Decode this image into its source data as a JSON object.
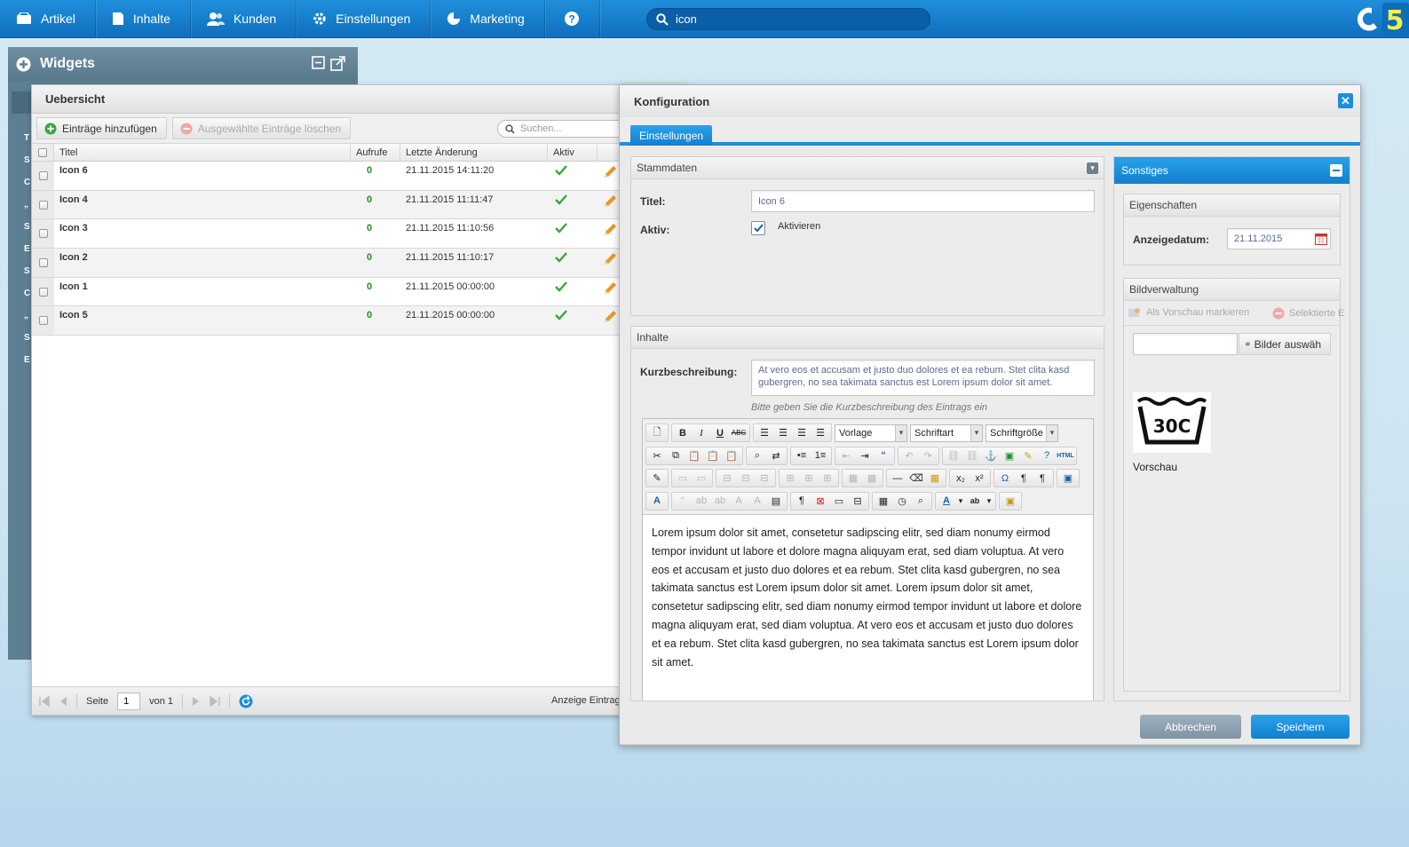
{
  "topnav": {
    "items": [
      {
        "label": "Artikel",
        "icon": "articles-icon"
      },
      {
        "label": "Inhalte",
        "icon": "content-icon"
      },
      {
        "label": "Kunden",
        "icon": "customers-icon"
      },
      {
        "label": "Einstellungen",
        "icon": "gear-icon"
      },
      {
        "label": "Marketing",
        "icon": "pie-chart-icon"
      }
    ],
    "help_icon": "help-icon",
    "search_value": "icon",
    "logo_icon": "shopware-logo-icon"
  },
  "widgets": {
    "title": "Widgets",
    "partial_letters": "T\nS\nC\n„\nS\nE\nS\nC\n„\nS\nE"
  },
  "uebersicht": {
    "title": "Uebersicht",
    "add_label": "Einträge hinzufügen",
    "delete_label": "Ausgewählte Einträge löschen",
    "search_placeholder": "Suchen...",
    "columns": {
      "title": "Titel",
      "hits": "Aufrufe",
      "date": "Letzte Änderung",
      "active": "Aktiv"
    },
    "rows": [
      {
        "title": "Icon 6",
        "hits": "0",
        "date": "21.11.2015 14:11:20"
      },
      {
        "title": "Icon 4",
        "hits": "0",
        "date": "21.11.2015 11:11:47"
      },
      {
        "title": "Icon 3",
        "hits": "0",
        "date": "21.11.2015 11:10:56"
      },
      {
        "title": "Icon 2",
        "hits": "0",
        "date": "21.11.2015 11:10:17"
      },
      {
        "title": "Icon 1",
        "hits": "0",
        "date": "21.11.2015 00:00:00"
      },
      {
        "title": "Icon 5",
        "hits": "0",
        "date": "21.11.2015 00:00:00"
      }
    ],
    "pager": {
      "page_label": "Seite",
      "page_value": "1",
      "of_label": "von 1",
      "display_label": "Anzeige Eintrag"
    }
  },
  "konfig": {
    "title": "Konfiguration",
    "tab": "Einstellungen",
    "stammdaten": {
      "heading": "Stammdaten",
      "title_label": "Titel:",
      "title_value": "Icon 6",
      "active_label": "Aktiv:",
      "active_option": "Aktivieren"
    },
    "inhalte": {
      "heading": "Inhalte",
      "short_label": "Kurzbeschreibung:",
      "short_value": "At vero eos et accusam et justo duo dolores et ea rebum. Stet clita kasd gubergren, no sea takimata sanctus est Lorem ipsum dolor sit amet.",
      "short_hint": "Bitte geben Sie die Kurzbeschreibung des Eintrags ein",
      "editor": {
        "select_format": "Vorlage",
        "select_font": "Schriftart",
        "select_size": "Schriftgröße",
        "body": "Lorem ipsum dolor sit amet, consetetur sadipscing elitr, sed diam nonumy eirmod tempor invidunt ut labore et dolore magna aliquyam erat, sed diam voluptua. At vero eos et accusam et justo duo dolores et ea rebum. Stet clita kasd gubergren, no sea takimata sanctus est Lorem ipsum dolor sit amet. Lorem ipsum dolor sit amet, consetetur sadipscing elitr, sed diam nonumy eirmod tempor invidunt ut labore et dolore magna aliquyam erat, sed diam voluptua. At vero eos et accusam et justo duo dolores et ea rebum. Stet clita kasd gubergren, no sea takimata sanctus est Lorem ipsum dolor sit amet."
      }
    },
    "sonstiges": {
      "heading": "Sonstiges",
      "eigenschaften": "Eigenschaften",
      "date_label": "Anzeigedatum:",
      "date_value": "21.11.2015",
      "bildverwaltung": "Bildverwaltung",
      "mark_preview": "Als Vorschau markieren",
      "delete_selected": "Selektierte E",
      "choose_images": "Bilder auswäh",
      "image_text": "30C",
      "image_caption": "Vorschau"
    },
    "cancel_label": "Abbrechen",
    "save_label": "Speichern"
  },
  "colors": {
    "nav_blue": "#1a85d4",
    "accent_blue": "#1c8fd9",
    "check_green": "#3aa53a",
    "edit_orange": "#e8962c"
  }
}
